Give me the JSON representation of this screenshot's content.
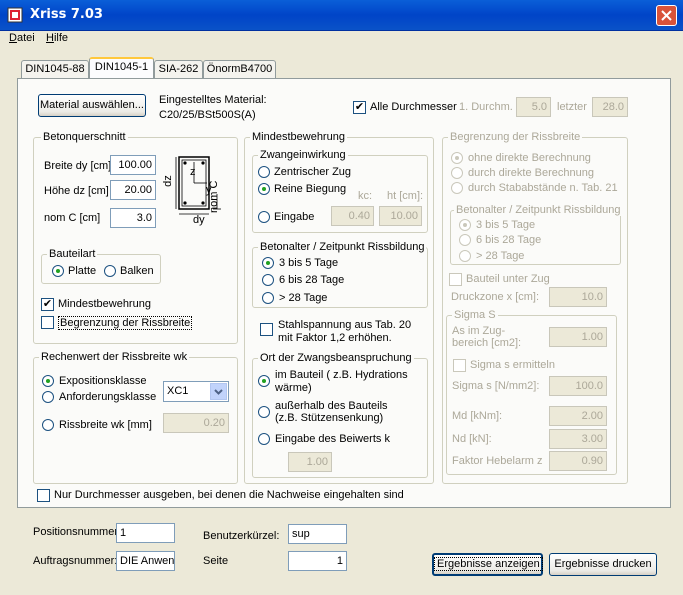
{
  "window": {
    "title": "Xriss 7.03"
  },
  "menu": [
    {
      "label": "Datei",
      "u": "D",
      "rest": "atei"
    },
    {
      "label": "Hilfe",
      "u": "H",
      "rest": "ilfe"
    }
  ],
  "tabs": [
    "DIN1045-88",
    "DIN1045-1",
    "SIA-262",
    "ÖnormB4700"
  ],
  "top": {
    "material_button": "Material auswählen...",
    "material_label": "Eingestelltes Material:",
    "material_value": "C20/25/BSt500S(A)",
    "alle_durchmesser": "Alle Durchmesser",
    "first_label": "1. Durchm.",
    "first_value": "5.0",
    "last_label": "letzter",
    "last_value": "28.0"
  },
  "beton": {
    "title": "Betonquerschnitt",
    "breite_label": "Breite dy [cm]",
    "breite_value": "100.00",
    "hoehe_label": "Höhe dz [cm]",
    "hoehe_value": "20.00",
    "nomc_label": "nom C [cm]",
    "nomc_value": "3.0",
    "diagram": {
      "dz": "dz",
      "dy": "dy",
      "z": "z",
      "y": "y",
      "nomc": "nom C"
    },
    "bauteilart_title": "Bauteilart",
    "platte": "Platte",
    "balken": "Balken",
    "mindest_chk": "Mindestbewehrung",
    "begrenzung_chk": "Begrenzung der Rissbreite"
  },
  "rechenwert": {
    "title": "Rechenwert der Rissbreite wk",
    "exposition": "Expositionsklasse",
    "anforderung": "Anforderungsklasse",
    "select_value": "XC1",
    "rissbreite": "Rissbreite wk [mm]",
    "rissbreite_value": "0.20"
  },
  "mindest": {
    "title": "Mindestbewehrung",
    "zwang_title": "Zwangeinwirkung",
    "zentrisch": "Zentrischer Zug",
    "reine": "Reine Biegung",
    "kc": "kc:",
    "ht": "ht [cm]:",
    "eingabe": "Eingabe",
    "kc_value": "0.40",
    "ht_value": "10.00",
    "alter_title": "Betonalter / Zeitpunkt Rissbildung",
    "a1": "3 bis 5 Tage",
    "a2": "6 bis 28 Tage",
    "a3": "> 28 Tage",
    "stahl_1": "Stahlspannung aus Tab. 20",
    "stahl_2": "mit Faktor 1,2 erhöhen.",
    "ort_title": "Ort der Zwangsbeanspruchung",
    "o1a": "im Bauteil ( z.B. Hydrations",
    "o1b": "wärme)",
    "o2a": "außerhalb des Bauteils",
    "o2b": "(z.B. Stützensenkung)",
    "o3": "Eingabe des Beiwerts k",
    "k_value": "1.00"
  },
  "begrenzung": {
    "title": "Begrenzung der Rissbreite",
    "r1": "ohne direkte Berechnung",
    "r2": "durch direkte Berechnung",
    "r3": "durch Stababstände n. Tab. 21",
    "alter_title": "Betonalter / Zeitpunkt Rissbildung",
    "a1": "3 bis 5 Tage",
    "a2": "6 bis 28 Tage",
    "a3": "> 28 Tage",
    "zug_chk": "Bauteil unter Zug",
    "druck_label": "Druckzone x [cm]:",
    "druck_value": "10.0",
    "sigma_title": "Sigma S",
    "as1": "As im Zug-",
    "as2": "bereich [cm2]:",
    "as_value": "1.00",
    "sigma_chk": "Sigma s ermitteln",
    "sigma_label": "Sigma s [N/mm2]:",
    "sigma_value": "100.0",
    "md_label": "Md [kNm]:",
    "md_value": "2.00",
    "nd_label": "Nd [kN]:",
    "nd_value": "3.00",
    "faktor_label": "Faktor Hebelarm z",
    "faktor_value": "0.90"
  },
  "nur_chk": "Nur Durchmesser ausgeben, bei denen die Nachweise eingehalten sind",
  "bottom": {
    "pos_label": "Positionsnummer:",
    "pos_value": "1",
    "auftrag_label": "Auftragsnummer:",
    "auftrag_value": "DIE Anwen",
    "benutzer_label": "Benutzerkürzel:",
    "benutzer_value": "sup",
    "seite_label": "Seite",
    "seite_value": "1",
    "ergebnisse_anzeigen": "Ergebnisse anzeigen",
    "ergebnisse_drucken": "Ergebnisse drucken"
  }
}
